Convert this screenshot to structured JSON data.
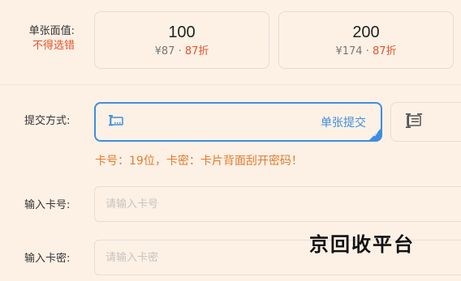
{
  "denomination": {
    "label": "单张面值:",
    "warning": "不得选错",
    "cards": [
      {
        "value": "100",
        "price": "¥87 · ",
        "discount": "87折"
      },
      {
        "value": "200",
        "price": "¥174 · ",
        "discount": "87折"
      }
    ]
  },
  "submit": {
    "label": "提交方式:",
    "methods": [
      {
        "label": "单张提交",
        "icon": "single-card-icon",
        "selected": true
      },
      {
        "label": "",
        "icon": "batch-card-icon",
        "selected": false
      }
    ],
    "hint": "卡号：19位，卡密：卡片背面刮开密码！"
  },
  "card_number": {
    "label": "输入卡号:",
    "placeholder": "请输入卡号"
  },
  "card_password": {
    "label": "输入卡密:",
    "placeholder": "请输入卡密"
  },
  "watermark": "京回收平台",
  "colors": {
    "background": "#fdf1e6",
    "accent": "#3f8edc",
    "warning": "#e3532d",
    "hint": "#e37a2c",
    "border": "#e4ddd6"
  }
}
